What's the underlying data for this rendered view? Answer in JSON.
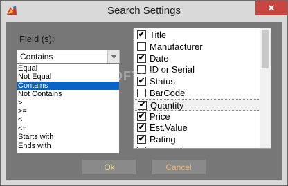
{
  "window": {
    "title": "Search Settings",
    "close_label": "✕"
  },
  "fields": {
    "label": "Field (s):",
    "selected_value": "Contains",
    "options": [
      "Equal",
      "Not Equal",
      "Contains",
      "Not Contains",
      ">",
      ">=",
      "<",
      "<=",
      "Starts with",
      "Ends with"
    ],
    "selected_index": 2
  },
  "columns": {
    "items": [
      {
        "label": "Title",
        "checked": true
      },
      {
        "label": "Manufacturer",
        "checked": false
      },
      {
        "label": "Date",
        "checked": true
      },
      {
        "label": "ID or Serial",
        "checked": false
      },
      {
        "label": "Status",
        "checked": true
      },
      {
        "label": "BarCode",
        "checked": false
      },
      {
        "label": "Quantity",
        "checked": true
      },
      {
        "label": "Price",
        "checked": true
      },
      {
        "label": "Est.Value",
        "checked": true
      },
      {
        "label": "Rating",
        "checked": true
      },
      {
        "label": "My Rating",
        "checked": true
      }
    ],
    "hover_index": 6
  },
  "buttons": {
    "ok_label": "Ok",
    "cancel_label": "Cancel"
  },
  "watermark": "SOFTPEDIA",
  "colors": {
    "selection": "#0a63c7",
    "close": "#c7463f",
    "ok_text": "#f2e08a",
    "cancel_text": "#f0b66a"
  }
}
